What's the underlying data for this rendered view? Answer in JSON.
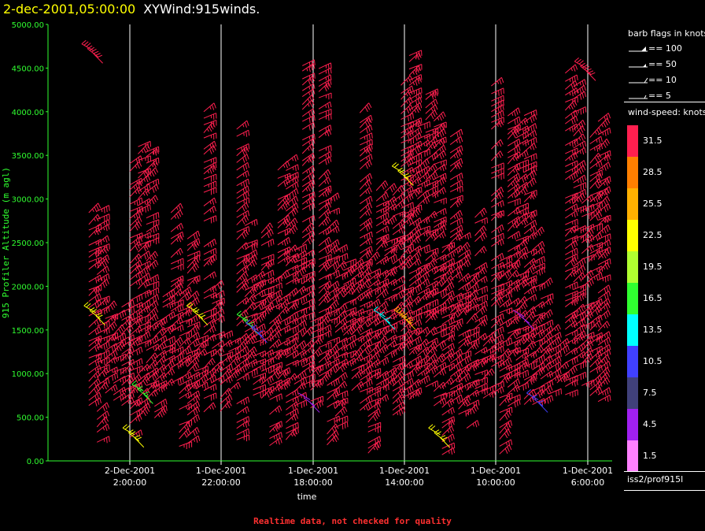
{
  "header": {
    "datetime": "2-dec-2001,05:00:00",
    "product": "XYWind:915winds."
  },
  "footer": {
    "note": "Realtime data, not checked for quality"
  },
  "legend": {
    "barb_title": "barb flags in knots",
    "barb_flags": [
      {
        "label": "== 100",
        "kind": "pennant"
      },
      {
        "label": "== 50",
        "kind": "triangle"
      },
      {
        "label": "== 10",
        "kind": "full"
      },
      {
        "label": "== 5",
        "kind": "half"
      }
    ],
    "speed_title": "wind-speed: knots",
    "speed_bins": [
      {
        "label": "31.5",
        "color": "#ff1f4f"
      },
      {
        "label": "28.5",
        "color": "#ff7f00"
      },
      {
        "label": "25.5",
        "color": "#ffb000"
      },
      {
        "label": "22.5",
        "color": "#ffff00"
      },
      {
        "label": "19.5",
        "color": "#b0ff30"
      },
      {
        "label": "16.5",
        "color": "#30ff30"
      },
      {
        "label": "13.5",
        "color": "#00ffff"
      },
      {
        "label": "10.5",
        "color": "#4040ff"
      },
      {
        "label": "7.5",
        "color": "#40407a"
      },
      {
        "label": "4.5",
        "color": "#a020f0"
      },
      {
        "label": "1.5",
        "color": "#ff80ff"
      }
    ],
    "station": "iss2/prof915l"
  },
  "chart_data": {
    "type": "scatter",
    "title": "",
    "xlabel": "time",
    "ylabel": "915 Profiler Altitude (m agl)",
    "ylim": [
      0,
      5000
    ],
    "yticks": [
      "5000.00",
      "4500.00",
      "4000.00",
      "3500.00",
      "3000.00",
      "2500.00",
      "2000.00",
      "1500.00",
      "1000.00",
      "500.00",
      "0.00"
    ],
    "x_direction": "time decreases to the right",
    "xticks": [
      {
        "date": "2-Dec-2001",
        "time": "2:00:00"
      },
      {
        "date": "1-Dec-2001",
        "time": "22:00:00"
      },
      {
        "date": "1-Dec-2001",
        "time": "18:00:00"
      },
      {
        "date": "1-Dec-2001",
        "time": "14:00:00"
      },
      {
        "date": "1-Dec-2001",
        "time": "10:00:00"
      },
      {
        "date": "1-Dec-2001",
        "time": "6:00:00"
      }
    ],
    "grid": "vertical lines at x ticks",
    "legend": "right side (wind-speed color key)",
    "series": [
      {
        "name": "wind barbs",
        "values": [
          {
            "x_hours_before_first_tick": -1.6,
            "altitude_m": 4700,
            "speed_kt": 31.5
          },
          {
            "x_hours_before_first_tick": -1.5,
            "altitude_m": 1700,
            "speed_kt": 22.5
          },
          {
            "x_hours_before_first_tick": 0.2,
            "altitude_m": 300,
            "speed_kt": 22.5
          },
          {
            "x_hours_before_first_tick": 0.6,
            "altitude_m": 800,
            "speed_kt": 16.5
          },
          {
            "x_hours_before_first_tick": 3.0,
            "altitude_m": 1700,
            "speed_kt": 22.5
          },
          {
            "x_hours_before_first_tick": 5.2,
            "altitude_m": 1600,
            "speed_kt": 16.5
          },
          {
            "x_hours_before_first_tick": 5.6,
            "altitude_m": 1500,
            "speed_kt": 10.5
          },
          {
            "x_hours_before_first_tick": 7.9,
            "altitude_m": 700,
            "speed_kt": 4.5
          },
          {
            "x_hours_before_first_tick": 11.2,
            "altitude_m": 1650,
            "speed_kt": 13.5
          },
          {
            "x_hours_before_first_tick": 12.0,
            "altitude_m": 3300,
            "speed_kt": 22.5
          },
          {
            "x_hours_before_first_tick": 12.1,
            "altitude_m": 1650,
            "speed_kt": 25.5
          },
          {
            "x_hours_before_first_tick": 13.6,
            "altitude_m": 300,
            "speed_kt": 22.5
          },
          {
            "x_hours_before_first_tick": 17.3,
            "altitude_m": 1650,
            "speed_kt": 4.5
          },
          {
            "x_hours_before_first_tick": 17.9,
            "altitude_m": 700,
            "speed_kt": 10.5
          },
          {
            "x_hours_before_first_tick": 20.0,
            "altitude_m": 4500,
            "speed_kt": 31.5
          }
        ]
      }
    ]
  }
}
